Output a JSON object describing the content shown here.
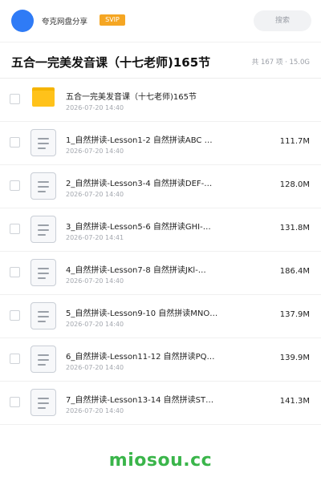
{
  "header": {
    "app_name": "夸克网盘分享",
    "badge": "SVIP",
    "search_placeholder": "搜索",
    "accent_color": "#2f7bf6",
    "badge_color": "#f5a623"
  },
  "folder": {
    "title": "五合一完美发音课（十七老师)165节",
    "meta": "共 167 项 · 15.0G"
  },
  "items": [
    {
      "type": "folder",
      "icon": "folder-icon",
      "name": "五合一完美发音课（十七老师)165节",
      "date": "2026-07-20 14:40",
      "size": ""
    },
    {
      "type": "file",
      "icon": "document-icon",
      "name": "1_自然拼读-Lesson1-2 自然拼读ABC …",
      "date": "2026-07-20 14:40",
      "size": "111.7M"
    },
    {
      "type": "file",
      "icon": "document-icon",
      "name": "2_自然拼读-Lesson3-4 自然拼读DEF-…",
      "date": "2026-07-20 14:40",
      "size": "128.0M"
    },
    {
      "type": "file",
      "icon": "document-icon",
      "name": "3_自然拼读-Lesson5-6 自然拼读GHI-…",
      "date": "2026-07-20 14:41",
      "size": "131.8M"
    },
    {
      "type": "file",
      "icon": "document-icon",
      "name": "4_自然拼读-Lesson7-8 自然拼读JKl-…",
      "date": "2026-07-20 14:40",
      "size": "186.4M"
    },
    {
      "type": "file",
      "icon": "document-icon",
      "name": "5_自然拼读-Lesson9-10 自然拼读MNO…",
      "date": "2026-07-20 14:40",
      "size": "137.9M"
    },
    {
      "type": "file",
      "icon": "document-icon",
      "name": "6_自然拼读-Lesson11-12 自然拼读PQ…",
      "date": "2026-07-20 14:40",
      "size": "139.9M"
    },
    {
      "type": "file",
      "icon": "document-icon",
      "name": "7_自然拼读-Lesson13-14 自然拼读ST…",
      "date": "2026-07-20 14:40",
      "size": "141.3M"
    }
  ],
  "watermark": {
    "text": "miosou.cc",
    "color": "#3ab54a"
  }
}
